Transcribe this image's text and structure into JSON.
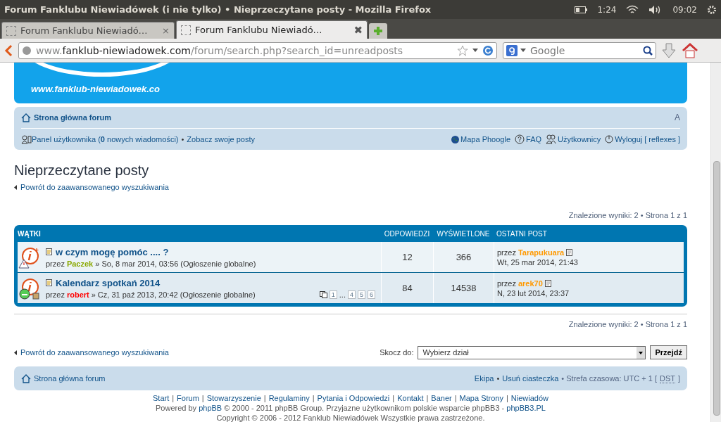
{
  "window": {
    "title": "Forum Fanklubu Niewiadówek (i nie tylko) • Nieprzeczytane posty - Mozilla Firefox"
  },
  "indicators": {
    "battery": "1:24",
    "clock": "09:02"
  },
  "tabs": [
    {
      "label": "Forum Fanklubu Niewiadó…",
      "selected": false,
      "close": "×"
    },
    {
      "label": "Forum Fanklubu Niewiadó…",
      "selected": true,
      "close": "✖"
    }
  ],
  "address_bar": {
    "url_prefix": "www.",
    "url_domain": "fanklub-niewiadowek.com",
    "url_path": "/forum/search.php?search_id=unreadposts"
  },
  "search": {
    "placeholder": "Google"
  },
  "banner": {
    "logo_text": "www.fanklub-niewiadowek.co"
  },
  "navbar": {
    "home": "Strona główna forum",
    "font_size": "A",
    "user_panel": "Panel użytkownika (**0** nowych wiadomości)",
    "sep": "•",
    "own_posts": "Zobacz swoje posty",
    "links": [
      {
        "kind": "globe",
        "label": "Mapa Phoogle"
      },
      {
        "kind": "faq",
        "label": "FAQ"
      },
      {
        "kind": "users",
        "label": "Użytkownicy"
      },
      {
        "kind": "logout",
        "label": "Wyloguj [ reflexes ]"
      }
    ]
  },
  "heading": "Nieprzeczytane posty",
  "back_link": "Powrót do zaawansowanego wyszukiwania",
  "results_top": "Znalezione wyniki: 2 • Strona 1 z 1",
  "table": {
    "columns": [
      "WĄTKI",
      "ODPOWIEDZI",
      "WYŚWIETLONE",
      "OSTATNI POST"
    ],
    "rows": [
      {
        "kind": "warning",
        "title": "w czym mogę pomóc .... ?",
        "by": "przez",
        "author": {
          "name": "Paczek",
          "color": "#8aa800"
        },
        "meta": "» So, 8 mar 2014, 03:56 (Ogłoszenie globalne)",
        "pages": [],
        "replies": "12",
        "views": "366",
        "last_by": "przez",
        "last_author": {
          "name": "Tarapukuara",
          "color": "#ff9900"
        },
        "last_date": "Wt, 25 mar 2014, 21:43"
      },
      {
        "kind": "smiley",
        "title": "Kalendarz spotkań 2014",
        "by": "przez",
        "author": {
          "name": "robert",
          "color": "#ff0000"
        },
        "meta": "» Cz, 31 paź 2013, 20:42 (Ogłoszenie globalne)",
        "pages": [
          {
            "kind": "page",
            "label": "1"
          },
          {
            "kind": "ellipsis",
            "label": "..."
          },
          {
            "kind": "page",
            "label": "4"
          },
          {
            "kind": "page",
            "label": "5"
          },
          {
            "kind": "page",
            "label": "6"
          }
        ],
        "replies": "84",
        "views": "14538",
        "last_by": "przez",
        "last_author": {
          "name": "arek70",
          "color": "#ff9900"
        },
        "last_date": "N, 23 lut 2014, 23:37"
      }
    ]
  },
  "results_bottom": "Znalezione wyniki: 2 • Strona 1 z 1",
  "back_link_bottom": "Powrót do zaawansowanego wyszukiwania",
  "jump": {
    "label": "Skocz do:",
    "value": "Wybierz dział",
    "button": "Przejdź"
  },
  "footer_nav": {
    "home": "Strona główna forum",
    "team": "Ekipa",
    "sep": "•",
    "cookies": "Usuń ciasteczka",
    "timezone": "• Strefa czasowa: UTC + 1 [",
    "dst": "DST",
    "close": "]"
  },
  "footer": {
    "links": [
      "Start",
      "Forum",
      "Stowarzyszenie",
      "Regulaminy",
      "Pytania i Odpowiedzi",
      "Kontakt",
      "Baner",
      "Mapa Strony",
      "Niewiadów"
    ],
    "sep": "|",
    "powered": [
      {
        "text": "Powered by ",
        "link": false
      },
      {
        "text": "phpBB",
        "link": true
      },
      {
        "text": " © 2000 - 2011 phpBB Group. Przyjazne użytkownikom polskie wsparcie phpBB3 - ",
        "link": false
      },
      {
        "text": "phpBB3.PL",
        "link": true
      }
    ],
    "copyright": "Copyright © 2006 - 2012 Fanklub Niewiadówek Wszystkie prawa zastrzeżone."
  }
}
